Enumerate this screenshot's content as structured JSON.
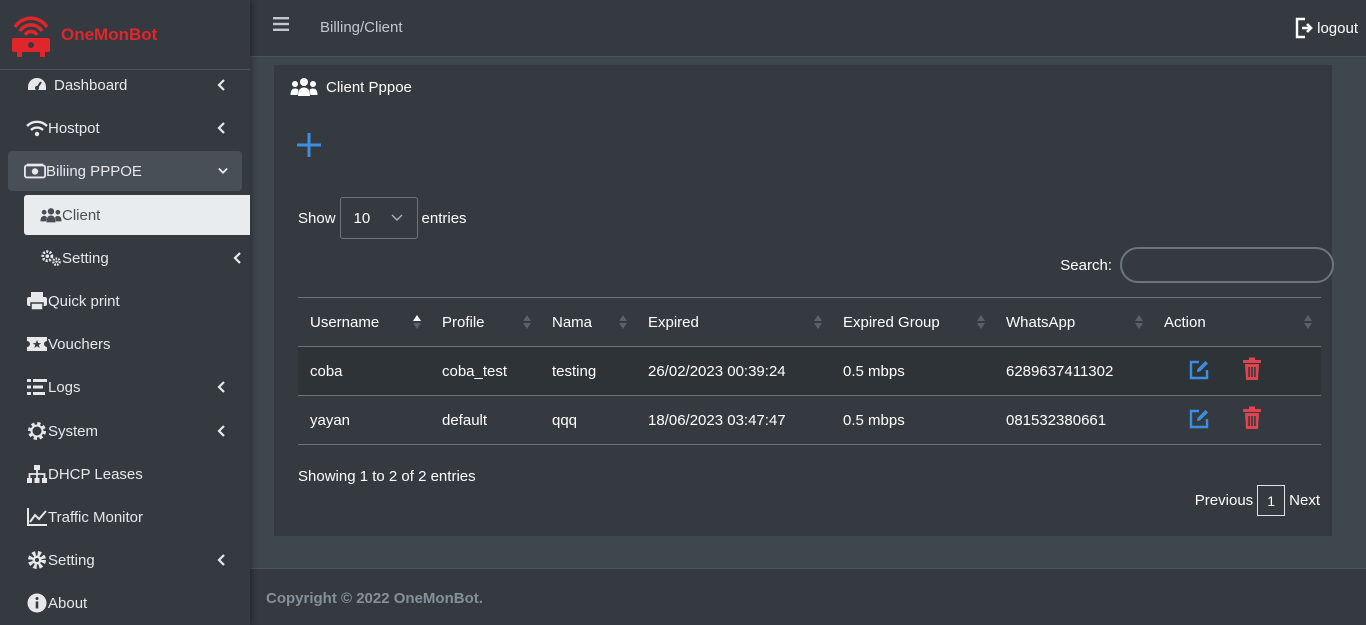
{
  "brand": {
    "name": "OneMonBot",
    "color": "#e0252b"
  },
  "sidebar": {
    "items": [
      {
        "label": "Dashboard",
        "icon": "gauge-icon",
        "has_chevron": true
      },
      {
        "label": "Hostpot",
        "icon": "wifi-icon",
        "has_chevron": true
      },
      {
        "label": "Biliing PPPOE",
        "icon": "money-icon",
        "has_chevron": true,
        "expanded": true
      },
      {
        "label": "Client",
        "icon": "users-icon",
        "active": true
      },
      {
        "label": "Setting",
        "icon": "cogs-icon",
        "has_chevron": true
      },
      {
        "label": "Quick print",
        "icon": "printer-icon"
      },
      {
        "label": "Vouchers",
        "icon": "ticket-icon"
      },
      {
        "label": "Logs",
        "icon": "list-icon",
        "has_chevron": true
      },
      {
        "label": "System",
        "icon": "gear-icon",
        "has_chevron": true
      },
      {
        "label": "DHCP Leases",
        "icon": "sitemap-icon"
      },
      {
        "label": "Traffic Monitor",
        "icon": "chart-line-icon"
      },
      {
        "label": "Setting",
        "icon": "gear-icon",
        "has_chevron": true
      },
      {
        "label": "About",
        "icon": "info-icon"
      }
    ]
  },
  "header": {
    "breadcrumb": "Billing/Client",
    "logout_label": "logout"
  },
  "card": {
    "title": "Client Pppoe"
  },
  "table_controls": {
    "show_label": "Show",
    "entries_label": "entries",
    "page_length": "10",
    "search_label": "Search:",
    "search_value": ""
  },
  "table": {
    "columns": [
      "Username",
      "Profile",
      "Nama",
      "Expired",
      "Expired Group",
      "WhatsApp",
      "Action"
    ],
    "rows": [
      [
        "coba",
        "coba_test",
        "testing",
        "26/02/2023 00:39:24",
        "0.5 mbps",
        "6289637411302"
      ],
      [
        "yayan",
        "default",
        "qqq",
        "18/06/2023 03:47:47",
        "0.5 mbps",
        "081532380661"
      ]
    ]
  },
  "pagination": {
    "info": "Showing 1 to 2 of 2 entries",
    "previous": "Previous",
    "current": "1",
    "next": "Next"
  },
  "footer": {
    "copyright": "Copyright © 2022 OneMonBot."
  },
  "colors": {
    "edit": "#3b8fe0",
    "delete": "#e0454f",
    "add": "#3b8fe0"
  }
}
